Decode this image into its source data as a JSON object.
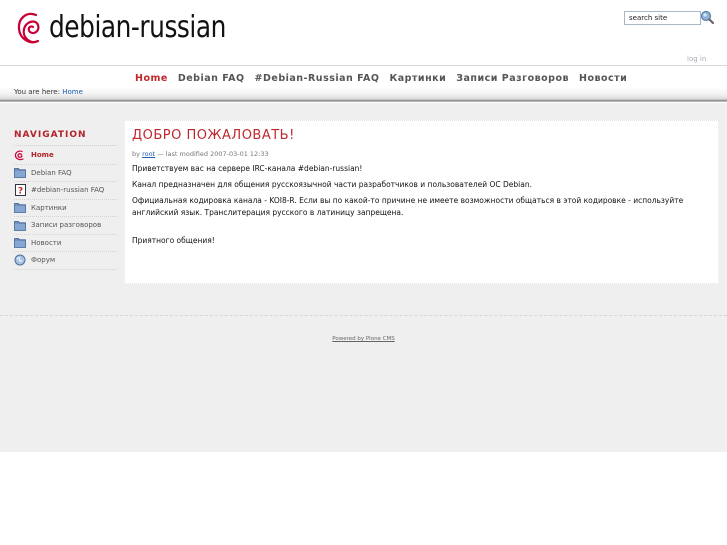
{
  "header": {
    "logo_text": "debian-russian",
    "search_placeholder": "search site",
    "search_value": "search site",
    "login_label": "log in"
  },
  "colors": {
    "accent": "#c0272d",
    "link": "#1a5fb4",
    "page_background": "#efefef"
  },
  "tabs": [
    {
      "label": "Home",
      "active": true
    },
    {
      "label": "Debian FAQ",
      "active": false
    },
    {
      "label": "#Debian-Russian FAQ",
      "active": false
    },
    {
      "label": "Картинки",
      "active": false
    },
    {
      "label": "Записи Разговоров",
      "active": false
    },
    {
      "label": "Новости",
      "active": false
    }
  ],
  "breadcrumb": {
    "prefix": "You are here:",
    "items": [
      "Home"
    ]
  },
  "sidebar": {
    "title": "NAVIGATION",
    "items": [
      {
        "label": "Home",
        "icon": "debian-swirl-icon",
        "active": true
      },
      {
        "label": "Debian FAQ",
        "icon": "folder-icon"
      },
      {
        "label": "#debian-russian FAQ",
        "icon": "help-document-icon"
      },
      {
        "label": "Картинки",
        "icon": "folder-icon"
      },
      {
        "label": "Записи разговоров",
        "icon": "folder-icon"
      },
      {
        "label": "Новости",
        "icon": "folder-icon"
      },
      {
        "label": "Форум",
        "icon": "forum-globe-icon"
      }
    ]
  },
  "document": {
    "title": "ДОБРО ПОЖАЛОВАТЬ!",
    "byline_prefix": "by",
    "author": "root",
    "byline_suffix": "— last modified 2007-03-01 12:33",
    "paragraphs": [
      "Приветствуем вас на сервере IRC-канала #debian-russian!",
      "Канал предназначен для общения русскоязычной части разработчиков и пользователей ОС Debian.",
      "Официальная кодировка канала - KOI8-R. Если вы по какой-то причине не имеете возможности общаться в этой кодировке - используйте английский язык. Транслитерация русского в латиницу запрещена.",
      "Приятного общения!"
    ]
  },
  "footer": {
    "powered_by": "Powered by Plone CMS"
  }
}
